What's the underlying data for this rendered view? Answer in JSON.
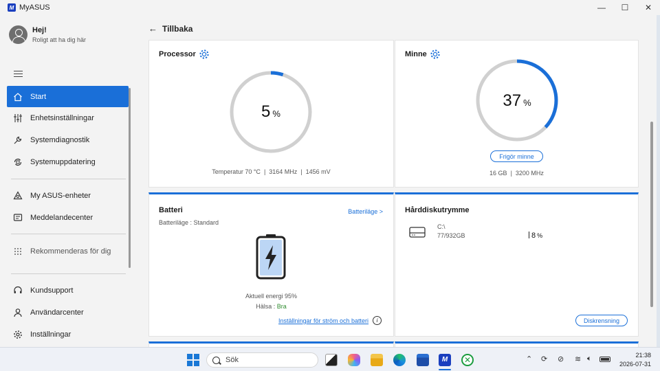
{
  "window": {
    "title": "MyASUS",
    "logo_text": "M",
    "controls": [
      "—",
      "☐",
      "✕"
    ]
  },
  "user": {
    "greeting": "Hej!",
    "subtitle": "Roligt att ha dig här"
  },
  "sidebar": {
    "items": [
      {
        "label": "Start",
        "icon": "home-icon",
        "active": true
      },
      {
        "label": "Enhetsinställningar",
        "icon": "sliders-icon"
      },
      {
        "label": "Systemdiagnostik",
        "icon": "wrench-icon"
      },
      {
        "label": "Systemuppdatering",
        "icon": "update-icon"
      },
      {
        "label": "My ASUS-enheter",
        "icon": "devices-icon"
      },
      {
        "label": "Meddelandecenter",
        "icon": "message-icon"
      },
      {
        "label": "Rekommenderas för dig",
        "icon": "grid-dots-icon"
      },
      {
        "label": "Kundsupport",
        "icon": "headset-icon"
      },
      {
        "label": "Användarcenter",
        "icon": "person-icon"
      },
      {
        "label": "Inställningar",
        "icon": "gear-icon"
      }
    ]
  },
  "main": {
    "back_label": "Tillbaka",
    "processor": {
      "title": "Processor",
      "value": "5",
      "unit": "%",
      "percent": 5,
      "temp": "Temperatur 70 °C",
      "freq": "3164 MHz",
      "volt": "1456 mV"
    },
    "memory": {
      "title": "Minne",
      "value": "37",
      "unit": "%",
      "percent": 37,
      "button": "Frigör minne",
      "size": "16 GB",
      "freq": "3200 MHz"
    },
    "battery": {
      "title": "Batteri",
      "mode_link": "Batteriläge >",
      "mode": "Batteriläge : Standard",
      "energy": "Aktuell energi 95%",
      "health_label": "Hälsa : ",
      "health_value": "Bra",
      "settings_link": "Inställningar för ström och batteri",
      "info_icon": "i"
    },
    "disk": {
      "title": "Hårddiskutrymme",
      "drive": "C:\\",
      "usage": "77/932GB",
      "value": "8",
      "unit": "%",
      "button": "Diskrensning"
    }
  },
  "taskbar": {
    "search_placeholder": "Sök",
    "time": "21:38",
    "date": "2026-07-31"
  },
  "colors": {
    "accent": "#1a6fd8",
    "ring_track": "#d0d0d0",
    "health_good": "#2e8b2e"
  }
}
